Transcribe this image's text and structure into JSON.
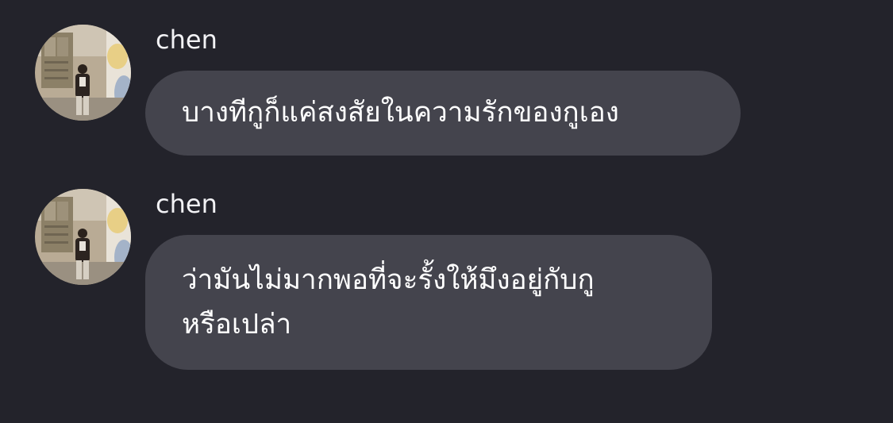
{
  "messages": [
    {
      "sender": "chen",
      "text": "บางทีกูก็แค่สงสัยในความรักของกูเอง",
      "avatar_icon": "profile-photo"
    },
    {
      "sender": "chen",
      "text": "ว่ามันไม่มากพอที่จะรั้งให้มึงอยู่กับกู\nหรือเปล่า",
      "avatar_icon": "profile-photo"
    }
  ],
  "colors": {
    "background": "#23232b",
    "bubble": "#44444d",
    "text": "#ffffff"
  }
}
